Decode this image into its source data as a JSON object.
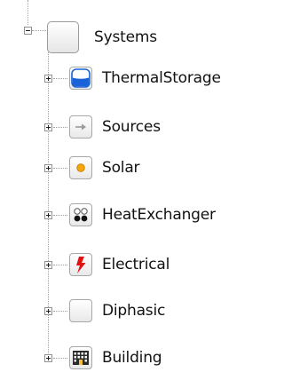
{
  "tree": {
    "root": {
      "label": "Systems",
      "icon": "blank-tile-icon"
    },
    "children": [
      {
        "label": "ThermalStorage",
        "icon": "tank-icon"
      },
      {
        "label": "Sources",
        "icon": "arrow-right-icon"
      },
      {
        "label": "Solar",
        "icon": "sun-dot-icon"
      },
      {
        "label": "HeatExchanger",
        "icon": "four-dots-icon"
      },
      {
        "label": "Electrical",
        "icon": "lightning-icon"
      },
      {
        "label": "Diphasic",
        "icon": "blank-tile-icon"
      },
      {
        "label": "Building",
        "icon": "building-icon"
      }
    ]
  },
  "colors": {
    "tank_blue": "#1a62d8",
    "solar_orange": "#f5a70a",
    "lightning_red": "#e21010",
    "connector_gray": "#a0a0a0"
  }
}
